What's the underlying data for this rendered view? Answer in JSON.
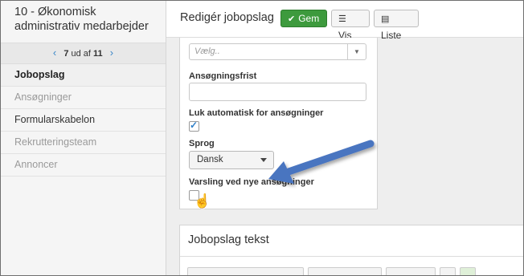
{
  "sidebar": {
    "title": "10 - Økonomisk administrativ medarbejder",
    "pager": {
      "current": "7",
      "separator": "ud af",
      "total": "11"
    },
    "items": [
      {
        "label": "Jobopslag",
        "state": "active"
      },
      {
        "label": "Ansøgninger",
        "state": "muted"
      },
      {
        "label": "Formularskabelon",
        "state": "normal"
      },
      {
        "label": "Rekrutteringsteam",
        "state": "muted"
      },
      {
        "label": "Annoncer",
        "state": "muted"
      }
    ]
  },
  "header": {
    "title": "Redigér jobopslag",
    "buttons": {
      "save": "Gem",
      "view": "Vis",
      "list": "Liste"
    }
  },
  "form": {
    "select_placeholder": "Vælg..",
    "deadline_label": "Ansøgningsfrist",
    "deadline_value": "",
    "auto_close_label": "Luk automatisk for ansøgninger",
    "auto_close_checked": true,
    "language_label": "Sprog",
    "language_value": "Dansk",
    "notify_label": "Varsling ved nye ansøgninger",
    "notify_checked": false
  },
  "text_panel": {
    "title": "Jobopslag tekst"
  },
  "colors": {
    "save_button": "#3d9a3d",
    "annotation_arrow": "#4a74c0",
    "link": "#3a87c8"
  },
  "icons": {
    "save": "check-icon",
    "view": "list-icon",
    "list": "list-alt-icon",
    "pager_prev": "chevron-left-icon",
    "pager_next": "chevron-right-icon",
    "cursor": "hand-pointer-icon"
  }
}
